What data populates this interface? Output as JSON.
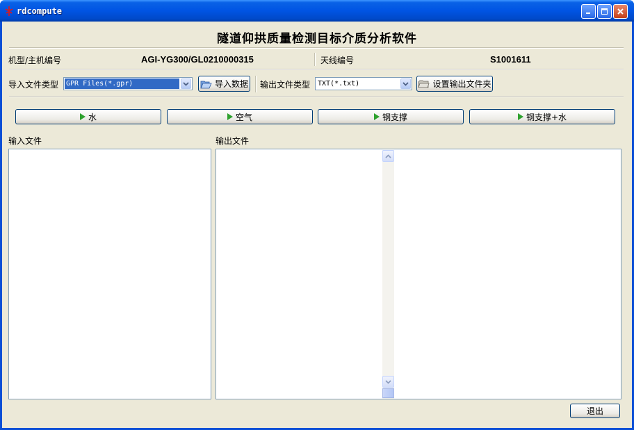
{
  "window": {
    "title": "rdcompute"
  },
  "header": {
    "title": "隧道仰拱质量检测目标介质分析软件"
  },
  "info": {
    "model_label": "机型/主机编号",
    "model_value": "AGI-YG300/GL0210000315",
    "antenna_label": "天线编号",
    "antenna_value": "S1001611"
  },
  "io": {
    "import_type_label": "导入文件类型",
    "import_type_value": "GPR Files(*.gpr)",
    "import_button": "导入数据",
    "export_type_label": "输出文件类型",
    "export_type_value": "TXT(*.txt)",
    "export_folder_button": "设置输出文件夹"
  },
  "media_buttons": [
    {
      "label": "水"
    },
    {
      "label": "空气"
    },
    {
      "label": "钢支撑"
    },
    {
      "label": "钢支撑+水"
    }
  ],
  "panels": {
    "input_label": "输入文件",
    "output_label": "输出文件"
  },
  "footer": {
    "exit_button": "退出"
  },
  "colors": {
    "titlebar": "#0054e3",
    "face": "#ece9d8",
    "selection": "#316ac5",
    "play_icon": "#2ea12e"
  }
}
